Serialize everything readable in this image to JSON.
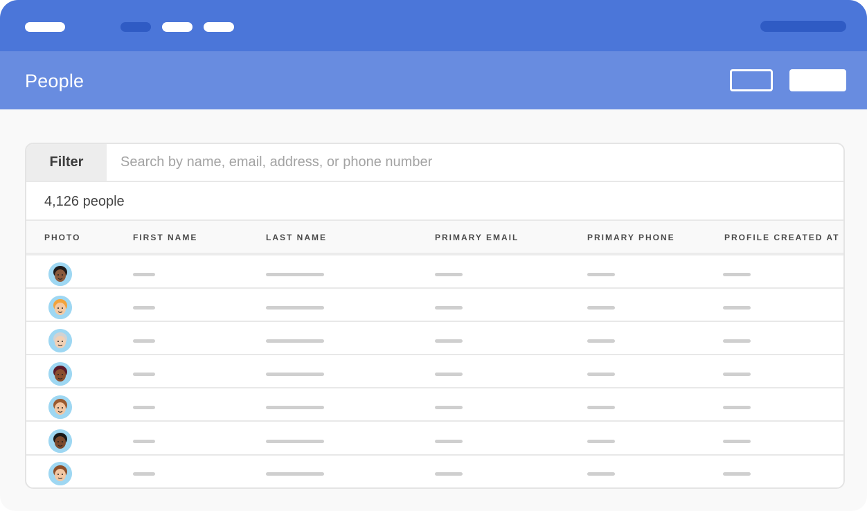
{
  "page": {
    "title": "People"
  },
  "filter": {
    "label": "Filter",
    "placeholder": "Search by name, email, address, or phone number"
  },
  "summary": {
    "count_text": "4,126 people"
  },
  "table": {
    "columns": [
      "PHOTO",
      "FIRST NAME",
      "LAST NAME",
      "PRIMARY EMAIL",
      "PRIMARY PHONE",
      "PROFILE CREATED AT"
    ],
    "rows": [
      {
        "avatar": "avatar-1",
        "skin": "#8a5a3c",
        "hair": "#1e1a1a"
      },
      {
        "avatar": "avatar-2",
        "skin": "#f3c9a3",
        "hair": "#f2a33b"
      },
      {
        "avatar": "avatar-3",
        "skin": "#f1d0b5",
        "hair": "#d2d2d2"
      },
      {
        "avatar": "avatar-4",
        "skin": "#8a4f2f",
        "hair": "#5b1a2a"
      },
      {
        "avatar": "avatar-5",
        "skin": "#f1c6a2",
        "hair": "#9b5a2f"
      },
      {
        "avatar": "avatar-6",
        "skin": "#7a4a2e",
        "hair": "#1a1a1a"
      },
      {
        "avatar": "avatar-7",
        "skin": "#f2c7a4",
        "hair": "#8e4f2a"
      }
    ]
  },
  "colors": {
    "topbar": "#4b76d9",
    "header": "#688ce0",
    "accent_dark": "#2f5bc4",
    "avatar_bg": "#9ed7f2",
    "placeholder_bar": "#cfcfcf"
  }
}
